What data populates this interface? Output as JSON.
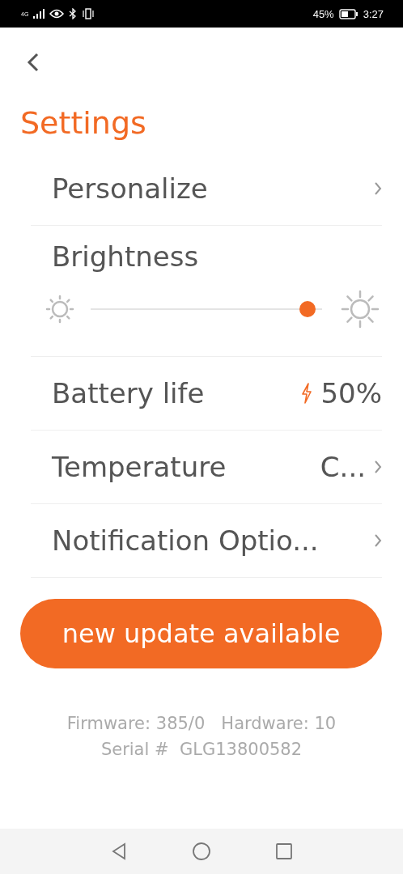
{
  "status_bar": {
    "network": "4G",
    "battery": "45%",
    "time": "3:27"
  },
  "title": "Settings",
  "rows": [
    {
      "kind": "link",
      "label": "Personalize"
    },
    {
      "kind": "slider",
      "label": "Brightness",
      "level": 0.97
    },
    {
      "kind": "battery",
      "label": "Battery life",
      "value": "50%"
    },
    {
      "kind": "link",
      "label": "Temperature",
      "value": "C..."
    },
    {
      "kind": "link",
      "label": "Notification Optio..."
    }
  ],
  "update_button": "new update available",
  "footer": [
    "Firmware: 385/0   Hardware: 10",
    "Serial #  GLG13800582"
  ]
}
